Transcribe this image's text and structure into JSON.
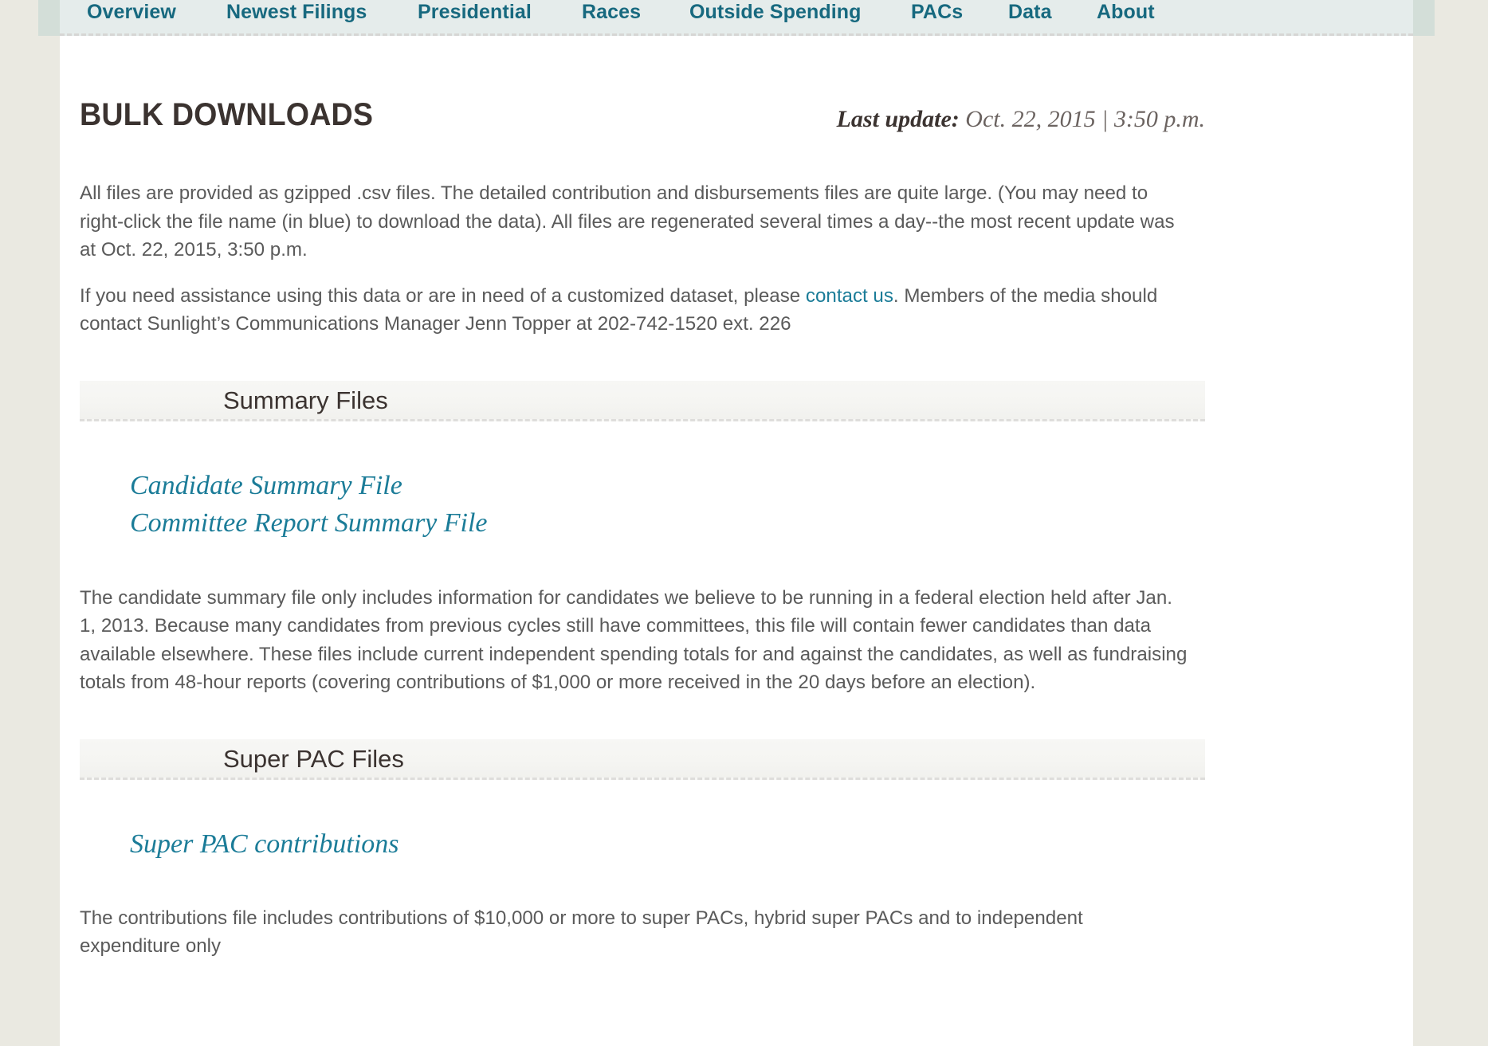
{
  "nav": {
    "items": [
      {
        "label": "Overview",
        "name": "nav-overview"
      },
      {
        "label": "Newest Filings",
        "name": "nav-newest-filings"
      },
      {
        "label": "Presidential",
        "name": "nav-presidential"
      },
      {
        "label": "Races",
        "name": "nav-races"
      },
      {
        "label": "Outside Spending",
        "name": "nav-outside-spending"
      },
      {
        "label": "PACs",
        "name": "nav-pacs"
      },
      {
        "label": "Data",
        "name": "nav-data"
      },
      {
        "label": "About",
        "name": "nav-about"
      }
    ]
  },
  "header": {
    "title": "BULK DOWNLOADS",
    "last_update_label": "Last update:",
    "last_update_value": " Oct. 22, 2015 | 3:50 p.m."
  },
  "intro": {
    "paragraph_1": "All files are provided as gzipped .csv files. The detailed contribution and disbursements files are quite large. (You may need to right-click the file name (in blue) to download the data). All files are regenerated several times a day--the most recent update was at Oct. 22, 2015, 3:50 p.m.",
    "paragraph_2_before_link": "If you need assistance using this data or are in need of a customized dataset, please ",
    "contact_link": "contact us",
    "paragraph_2_after_link": ". Members of the media should contact Sunlight’s Communications Manager Jenn Topper at 202-742-1520 ext. 226"
  },
  "sections": [
    {
      "heading": "Summary Files",
      "files": [
        "Candidate Summary File",
        "Committee Report Summary File"
      ],
      "description": "The candidate summary file only includes information for candidates we believe to be running in a federal election held after Jan. 1, 2013. Because many candidates from previous cycles still have committees, this file will contain fewer candidates than data available elsewhere. These files include current independent spending totals for and against the candidates, as well as fundraising totals from 48-hour reports (covering contributions of $1,000 or more received in the 20 days before an election)."
    },
    {
      "heading": "Super PAC Files",
      "files": [
        "Super PAC contributions"
      ],
      "description": "The contributions file includes contributions of $10,000 or more to super PACs, hybrid super PACs and to independent expenditure only"
    }
  ],
  "colors": {
    "page_background": "#eae9e1",
    "nav_background": "#e5eceb",
    "nav_shoulder": "#d3ded8",
    "nav_link": "#17697f",
    "content_background": "#ffffff",
    "heading_text": "#3b3330",
    "body_text": "#5a5a5a",
    "link_teal": "#1b7c98",
    "section_bar": "#f5f5f2",
    "dashed_border": "#dedddb"
  }
}
